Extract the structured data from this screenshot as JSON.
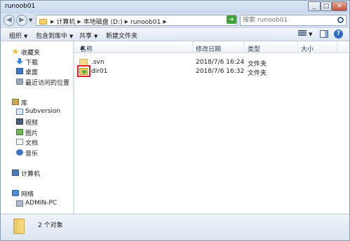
{
  "window": {
    "title": "runoob01"
  },
  "address": {
    "crumbs": [
      "计算机",
      "本地磁盘 (D:)",
      "runoob01"
    ]
  },
  "search": {
    "placeholder": "搜索 runoob01"
  },
  "toolbar": {
    "organize": "组织",
    "include": "包含到库中",
    "share": "共享",
    "new_folder": "新建文件夹"
  },
  "sidebar": {
    "favorites": {
      "label": "收藏夹",
      "icon": "star-icon"
    },
    "favorite_items": [
      {
        "label": "下载",
        "icon": "download-icon"
      },
      {
        "label": "桌面",
        "icon": "desktop-icon"
      },
      {
        "label": "最近访问的位置",
        "icon": "recent-places-icon"
      }
    ],
    "libraries": {
      "label": "库",
      "icon": "library-icon"
    },
    "library_items": [
      {
        "label": "Subversion",
        "icon": "subversion-icon"
      },
      {
        "label": "视频",
        "icon": "video-icon"
      },
      {
        "label": "图片",
        "icon": "pictures-icon"
      },
      {
        "label": "文档",
        "icon": "documents-icon"
      },
      {
        "label": "音乐",
        "icon": "music-icon"
      }
    ],
    "computer": {
      "label": "计算机",
      "icon": "computer-icon"
    },
    "network": {
      "label": "网络",
      "icon": "network-icon"
    },
    "network_items": [
      {
        "label": "ADMIN-PC",
        "icon": "pc-icon"
      }
    ]
  },
  "columns": {
    "name": "名称",
    "date": "修改日期",
    "type": "类型",
    "size": "大小"
  },
  "files": [
    {
      "name": ".svn",
      "date": "2018/7/6 16:24",
      "type": "文件夹",
      "size": ""
    },
    {
      "name": "dir01",
      "date": "2018/7/6 16:32",
      "type": "文件夹",
      "size": ""
    }
  ],
  "status": {
    "text": "2 个对象"
  },
  "colors": {
    "highlight_box": "#e2202a",
    "chrome": "#d8e3ef"
  }
}
